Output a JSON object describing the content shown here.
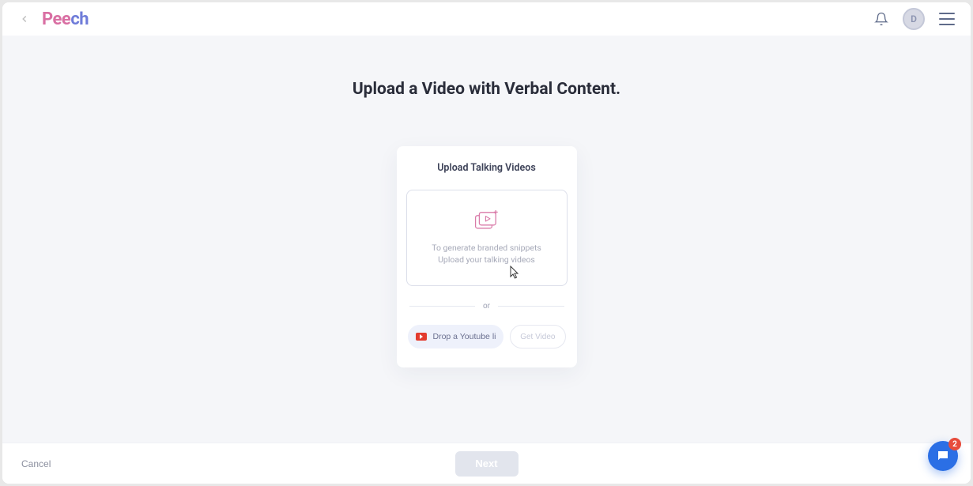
{
  "header": {
    "logo_left": "Pee",
    "logo_right": "ch",
    "avatar_initial": "D"
  },
  "main": {
    "title": "Upload a Video with Verbal Content.",
    "card": {
      "title": "Upload Talking Videos",
      "dropzone_line1": "To generate branded snippets",
      "dropzone_line2": "Upload your talking videos",
      "divider": "or",
      "youtube_placeholder": "Drop a Youtube link",
      "get_video": "Get Video"
    }
  },
  "footer": {
    "cancel": "Cancel",
    "next": "Next"
  },
  "chat": {
    "badge": "2"
  }
}
